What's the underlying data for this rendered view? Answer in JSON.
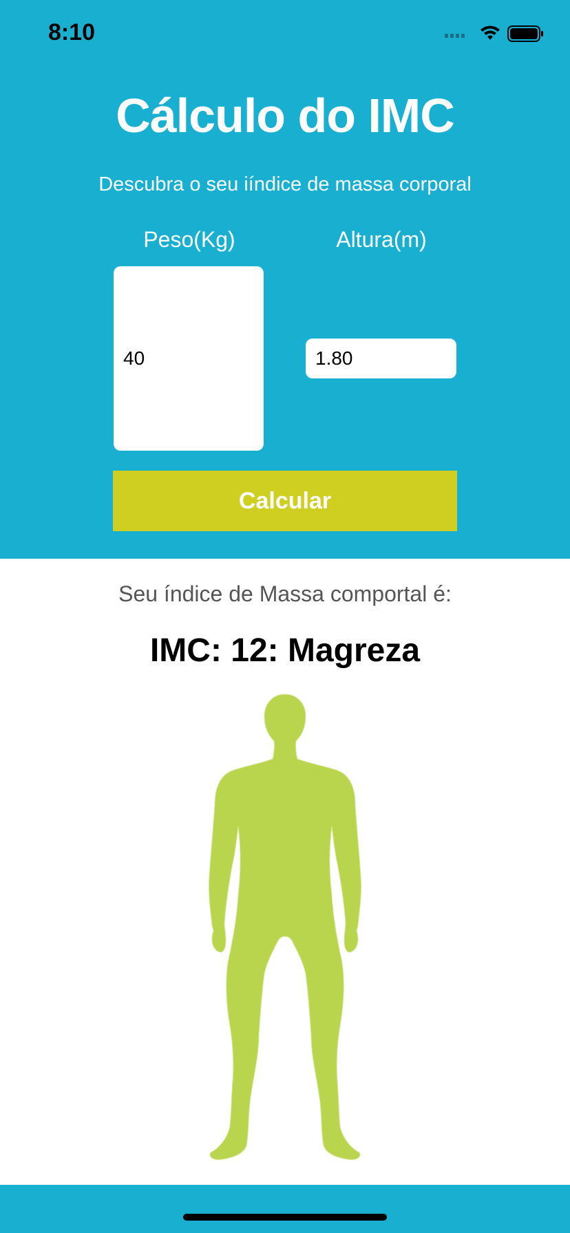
{
  "status": {
    "time": "8:10"
  },
  "header": {
    "title": "Cálculo do IMC",
    "subtitle": "Descubra o seu iíndice de massa corporal"
  },
  "form": {
    "weight_label": "Peso(Kg)",
    "weight_value": "40",
    "height_label": "Altura(m)",
    "height_value": "1.80",
    "calculate_label": "Calcular"
  },
  "result": {
    "label": "Seu índice de Massa comportal é:",
    "value": "IMC: 12:  Magreza"
  },
  "colors": {
    "header_bg": "#19afd1",
    "button_bg": "#cfcf22",
    "silhouette": "#b9d54e"
  },
  "icons": [
    "cellular-signal-icon",
    "wifi-icon",
    "battery-icon",
    "body-silhouette-icon"
  ]
}
